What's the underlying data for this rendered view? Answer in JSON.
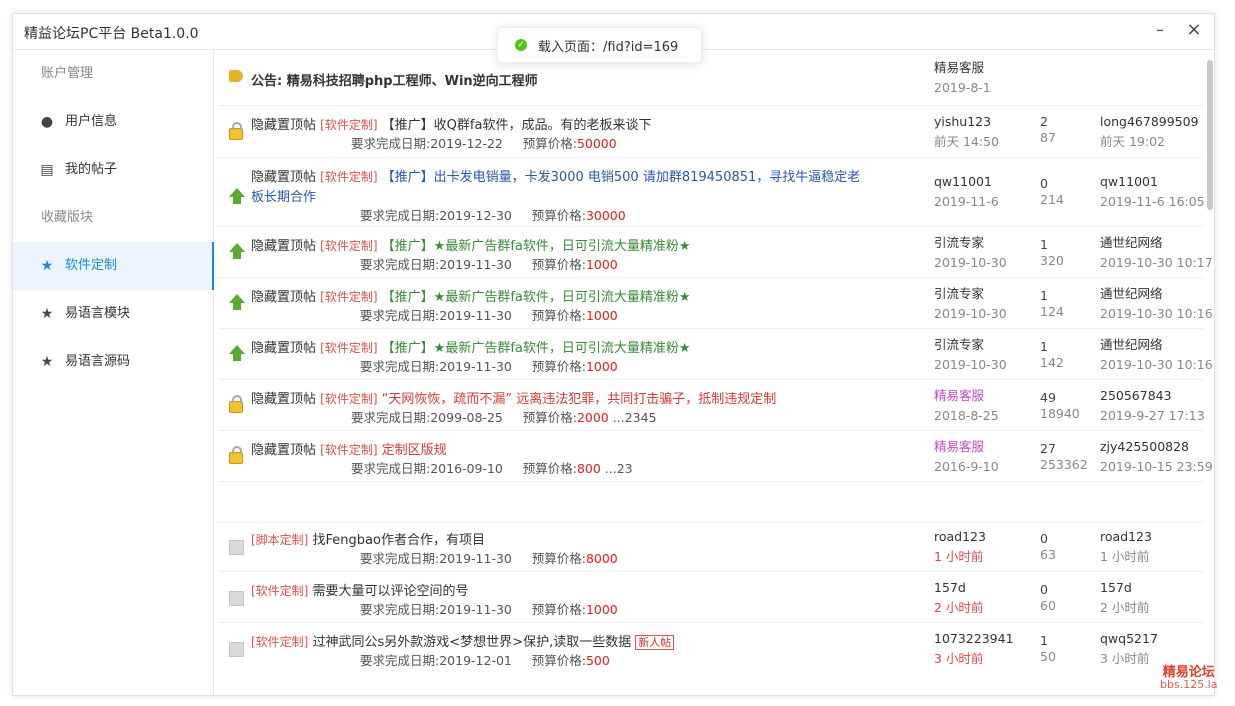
{
  "window": {
    "title": "精益论坛PC平台 Beta1.0.0",
    "minimize": "–",
    "close": "×"
  },
  "toast": {
    "text": "载入页面：/fid?id=169"
  },
  "sidebar": {
    "account_header": "账户管理",
    "items": [
      {
        "label": "用户信息",
        "icon": "user-circle-icon",
        "glyph": "●"
      },
      {
        "label": "我的帖子",
        "icon": "book-icon",
        "glyph": "▤"
      }
    ],
    "favorites_header": "收藏版块",
    "favorites": [
      {
        "label": "软件定制",
        "icon": "star-icon",
        "glyph": "★",
        "active": true
      },
      {
        "label": "易语言模块",
        "icon": "star-icon",
        "glyph": "★"
      },
      {
        "label": "易语言源码",
        "icon": "star-icon",
        "glyph": "★"
      }
    ]
  },
  "announcement": {
    "label": "公告:",
    "title": "精易科技招聘php工程师、Win逆向工程师",
    "author": "精易客服",
    "date": "2019-8-1"
  },
  "threads": [
    {
      "prefix": "隐藏置顶帖",
      "tag": "[软件定制]",
      "title": "【推广】收Q群fa软件，成品。有的老板来谈下",
      "due": "要求完成日期:2019-12-22",
      "price_label": "预算价格:",
      "price": "50000",
      "pages": "",
      "author": "yishu123",
      "date": "前天 14:50",
      "replies": "2",
      "views": "87",
      "last_user": "long467899509",
      "last_time": "前天 19:02"
    },
    {
      "prefix": "隐藏置顶帖",
      "tag": "[软件定制]",
      "title": "【推广】出卡发电销量，卡发3000 电销500 请加群819450851，寻找牛逼稳定老",
      "title2": "板长期合作",
      "due": "要求完成日期:2019-12-30",
      "price_label": "预算价格:",
      "price": "30000",
      "pages": "",
      "author": "qw11001",
      "date": "2019-11-6",
      "replies": "0",
      "views": "214",
      "last_user": "qw11001",
      "last_time": "2019-11-6 16:05"
    },
    {
      "prefix": "隐藏置顶帖",
      "tag": "[软件定制]",
      "title": "【推广】★最新广告群fa软件，日可引流大量精准粉★",
      "due": "要求完成日期:2019-11-30",
      "price_label": "预算价格:",
      "price": "1000",
      "pages": "",
      "author": "引流专家",
      "date": "2019-10-30",
      "replies": "1",
      "views": "320",
      "last_user": "通世纪网络",
      "last_time": "2019-10-30 10:17"
    },
    {
      "prefix": "隐藏置顶帖",
      "tag": "[软件定制]",
      "title": "【推广】★最新广告群fa软件，日可引流大量精准粉★",
      "due": "要求完成日期:2019-11-30",
      "price_label": "预算价格:",
      "price": "1000",
      "pages": "",
      "author": "引流专家",
      "date": "2019-10-30",
      "replies": "1",
      "views": "124",
      "last_user": "通世纪网络",
      "last_time": "2019-10-30 10:16"
    },
    {
      "prefix": "隐藏置顶帖",
      "tag": "[软件定制]",
      "title": "【推广】★最新广告群fa软件，日可引流大量精准粉★",
      "due": "要求完成日期:2019-11-30",
      "price_label": "预算价格:",
      "price": "1000",
      "pages": "",
      "author": "引流专家",
      "date": "2019-10-30",
      "replies": "1",
      "views": "142",
      "last_user": "通世纪网络",
      "last_time": "2019-10-30 10:16"
    },
    {
      "prefix": "隐藏置顶帖",
      "tag": "[软件定制]",
      "title": "“天网恢恢，疏而不漏” 远离违法犯罪，共同打击骗子，抵制违规定制",
      "due": "要求完成日期:2099-08-25",
      "price_label": "预算价格:",
      "price": "2000",
      "pages": "...2345",
      "author": "精易客服",
      "date": "2018-8-25",
      "replies": "49",
      "views": "18940",
      "last_user": "250567843",
      "last_time": "2019-9-27 17:13"
    },
    {
      "prefix": "隐藏置顶帖",
      "tag": "[软件定制]",
      "title": "定制区版规",
      "due": "要求完成日期:2016-09-10",
      "price_label": "预算价格:",
      "price": "800",
      "pages": "...23",
      "author": "精易客服",
      "date": "2016-9-10",
      "replies": "27",
      "views": "253362",
      "last_user": "zjy425500828",
      "last_time": "2019-10-15 23:59"
    },
    {
      "prefix": "",
      "tag": "[脚本定制]",
      "title": "找Fengbao作者合作，有项目",
      "due": "要求完成日期:2019-11-30",
      "price_label": "预算价格:",
      "price": "8000",
      "pages": "",
      "author": "road123",
      "date": "1 小时前",
      "replies": "0",
      "views": "63",
      "last_user": "road123",
      "last_time": "1 小时前"
    },
    {
      "prefix": "",
      "tag": "[软件定制]",
      "title": "需要大量可以评论空间的号",
      "due": "要求完成日期:2019-11-30",
      "price_label": "预算价格:",
      "price": "1000",
      "pages": "",
      "author": "157d",
      "date": "2 小时前",
      "replies": "0",
      "views": "60",
      "last_user": "157d",
      "last_time": "2 小时前"
    },
    {
      "prefix": "",
      "tag": "[软件定制]",
      "title": "过神武同公s另外款游戏<梦想世界>保护,读取一些数据",
      "badge": "新人帖",
      "due": "要求完成日期:2019-12-01",
      "price_label": "预算价格:",
      "price": "500",
      "pages": "",
      "author": "1073223941",
      "date": "3 小时前",
      "replies": "1",
      "views": "50",
      "last_user": "qwq5217",
      "last_time": "3 小时前"
    }
  ],
  "watermark": {
    "line1": "精易论坛",
    "line2": "bbs.125.la"
  }
}
